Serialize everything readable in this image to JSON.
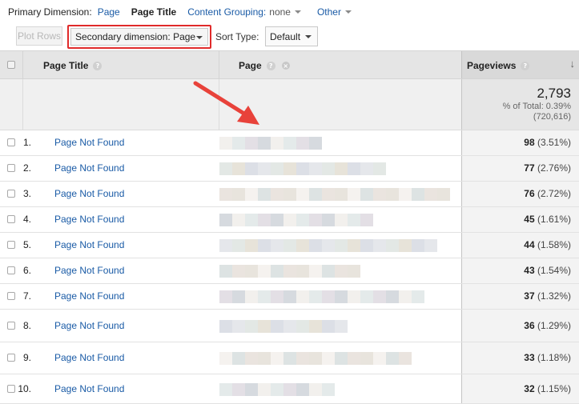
{
  "dimension_bar": {
    "primary_label": "Primary Dimension:",
    "page_link": "Page",
    "page_title_active": "Page Title",
    "content_grouping_label": "Content Grouping:",
    "content_grouping_value": "none",
    "other_label": "Other"
  },
  "toolbar": {
    "plot_rows_label": "Plot Rows",
    "secondary_dimension_label": "Secondary dimension: Page",
    "sort_type_label": "Sort Type:",
    "sort_type_value": "Default"
  },
  "table": {
    "columns": {
      "page_title": "Page Title",
      "page": "Page",
      "pageviews": "Pageviews"
    },
    "help_glyph": "?",
    "remove_glyph": "×",
    "sort_glyph": "↓",
    "totals": {
      "value": "2,793",
      "percent_line": "% of Total: 0.39%",
      "total_line": "(720,616)"
    },
    "rows": [
      {
        "num": "1.",
        "title": "Page Not Found",
        "value": "98",
        "pct": "(3.51%)"
      },
      {
        "num": "2.",
        "title": "Page Not Found",
        "value": "77",
        "pct": "(2.76%)"
      },
      {
        "num": "3.",
        "title": "Page Not Found",
        "value": "76",
        "pct": "(2.72%)"
      },
      {
        "num": "4.",
        "title": "Page Not Found",
        "value": "45",
        "pct": "(1.61%)"
      },
      {
        "num": "5.",
        "title": "Page Not Found",
        "value": "44",
        "pct": "(1.58%)"
      },
      {
        "num": "6.",
        "title": "Page Not Found",
        "value": "43",
        "pct": "(1.54%)"
      },
      {
        "num": "7.",
        "title": "Page Not Found",
        "value": "37",
        "pct": "(1.32%)"
      },
      {
        "num": "8.",
        "title": "Page Not Found",
        "value": "36",
        "pct": "(1.29%)"
      },
      {
        "num": "9.",
        "title": "Page Not Found",
        "value": "33",
        "pct": "(1.18%)"
      },
      {
        "num": "10.",
        "title": "Page Not Found",
        "value": "32",
        "pct": "(1.15%)"
      }
    ]
  },
  "colors": {
    "link_blue": "#1a5ba6",
    "highlight_red": "#e02a2a",
    "arrow_red": "#e8423a",
    "header_gray": "#e5e5e5"
  },
  "icons": [
    "help-icon",
    "remove-dimension-icon",
    "sort-descending-icon",
    "dropdown-caret-icon",
    "checkbox-icon",
    "annotation-arrow-icon"
  ]
}
